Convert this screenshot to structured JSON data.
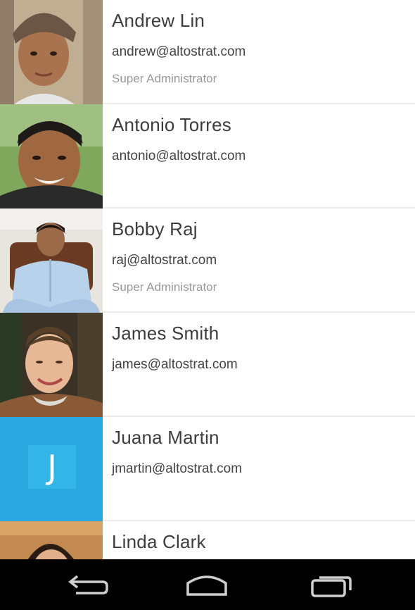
{
  "users": [
    {
      "name": "Andrew Lin",
      "email": "andrew@altostrat.com",
      "role": "Super Administrator",
      "avatar": "photo"
    },
    {
      "name": "Antonio Torres",
      "email": "antonio@altostrat.com",
      "role": "",
      "avatar": "photo"
    },
    {
      "name": "Bobby Raj",
      "email": "raj@altostrat.com",
      "role": "Super Administrator",
      "avatar": "photo"
    },
    {
      "name": "James Smith",
      "email": "james@altostrat.com",
      "role": "",
      "avatar": "photo"
    },
    {
      "name": "Juana Martin",
      "email": "jmartin@altostrat.com",
      "role": "",
      "avatar": "letter",
      "initial": "J",
      "avatar_color": "#2aa9e0"
    },
    {
      "name": "Linda Clark",
      "email": "",
      "role": "",
      "avatar": "photo"
    }
  ],
  "nav_bar": {
    "icons": [
      "back-icon",
      "home-icon",
      "recent-apps-icon"
    ],
    "color": "#000000"
  }
}
